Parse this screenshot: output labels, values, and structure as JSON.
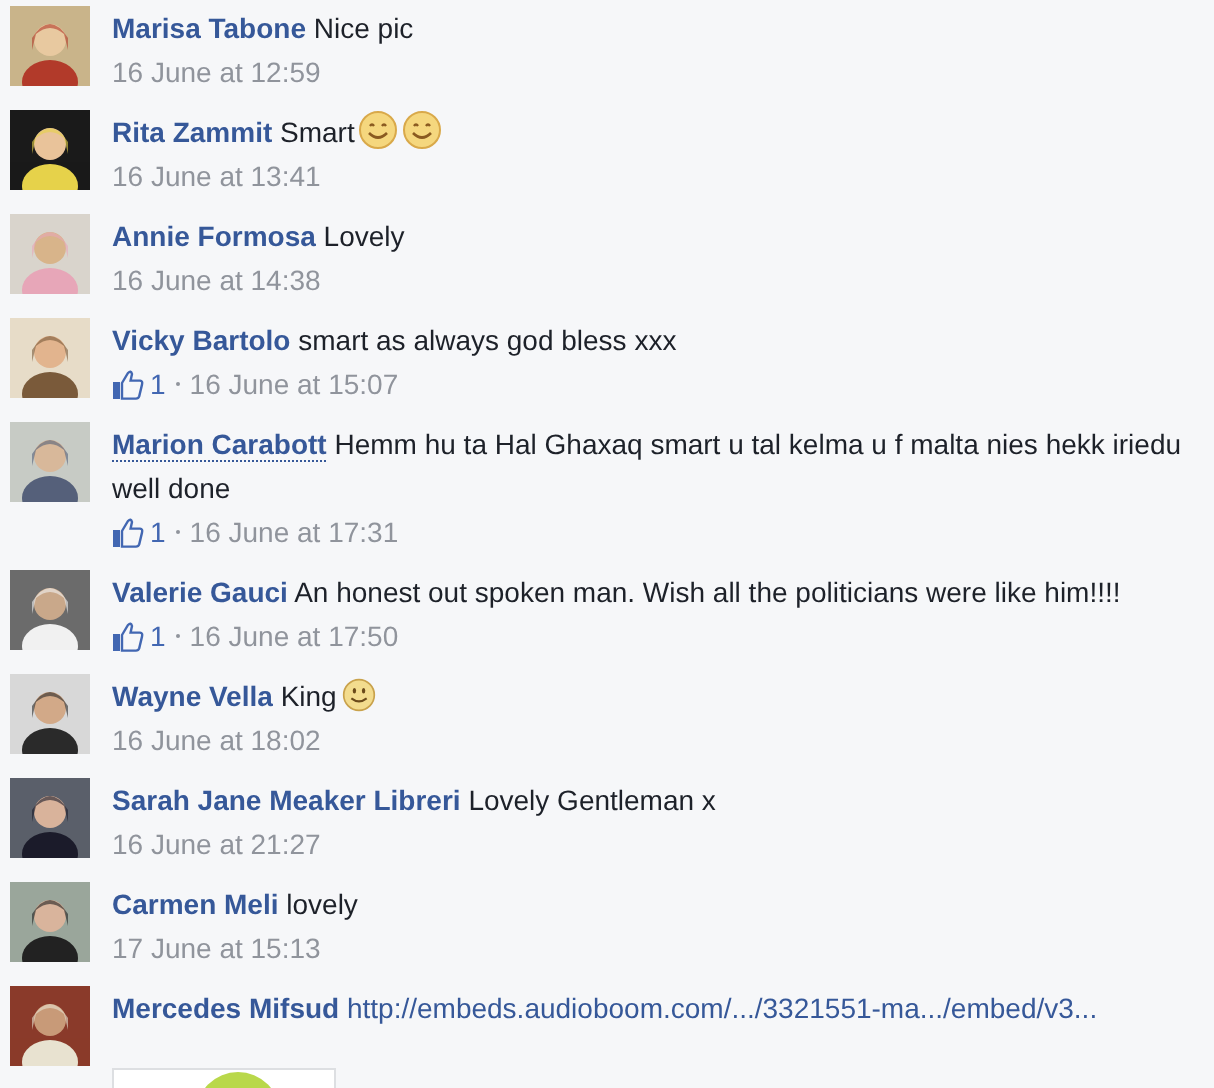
{
  "comments": [
    {
      "name": "Marisa Tabone",
      "hovered": false,
      "text": "Nice pic",
      "time": "16 June at 12:59",
      "avatar": {
        "kind": "picture"
      }
    },
    {
      "name": "Rita Zammit",
      "hovered": false,
      "text": "Smart",
      "emojis": [
        {
          "kind": "smile"
        },
        {
          "kind": "smile"
        }
      ],
      "time": "16 June at 13:41",
      "avatar": {
        "kind": "picture"
      }
    },
    {
      "name": "Annie Formosa",
      "hovered": false,
      "text": "Lovely",
      "time": "16 June at 14:38",
      "avatar": {
        "kind": "picture"
      }
    },
    {
      "name": "Vicky Bartolo",
      "hovered": false,
      "text": "smart as always god bless xxx",
      "likes": "1",
      "time": "16 June at 15:07",
      "avatar": {
        "kind": "picture"
      }
    },
    {
      "name": "Marion Carabott",
      "hovered": true,
      "text": "Hemm hu ta Hal Ghaxaq smart u tal kelma u f malta nies hekk iriedu well done",
      "likes": "1",
      "time": "16 June at 17:31",
      "avatar": {
        "kind": "picture"
      }
    },
    {
      "name": "Valerie Gauci",
      "hovered": false,
      "text": "An honest out spoken man. Wish all the politicians were like him!!!!",
      "likes": "1",
      "time": "16 June at 17:50",
      "avatar": {
        "kind": "picture"
      }
    },
    {
      "name": "Wayne Vella",
      "hovered": false,
      "text": "King",
      "emojis": [
        {
          "kind": "slight_smile"
        }
      ],
      "time": "16 June at 18:02",
      "avatar": {
        "kind": "picture"
      }
    },
    {
      "name": "Sarah Jane Meaker Libreri",
      "hovered": false,
      "text": "Lovely Gentleman x",
      "time": "16 June at 21:27",
      "avatar": {
        "kind": "picture"
      }
    },
    {
      "name": "Carmen Meli",
      "hovered": false,
      "text": "lovely",
      "time": "17 June at 15:13",
      "avatar": {
        "kind": "picture"
      }
    },
    {
      "name": "Mercedes Mifsud",
      "hovered": false,
      "link": "http://embeds.audioboom.com/.../3321551-ma.../embed/v3...",
      "avatar": {
        "kind": "picture"
      },
      "preview": {
        "kind": "picture"
      }
    }
  ]
}
